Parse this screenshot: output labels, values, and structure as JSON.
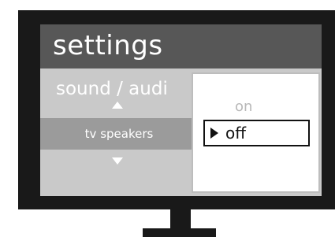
{
  "screen": {
    "title": "settings",
    "breadcrumb": "sound / audi"
  },
  "menu": {
    "selected_item": "tv speakers"
  },
  "dropdown": {
    "options": [
      "on",
      "off"
    ],
    "selected": "off"
  },
  "colors": {
    "bezel": "#191919",
    "screen_bg": "#c9c9c9",
    "titlebar": "#575757",
    "selected_row": "#9b9b9b",
    "popup_bg": "#ffffff"
  }
}
